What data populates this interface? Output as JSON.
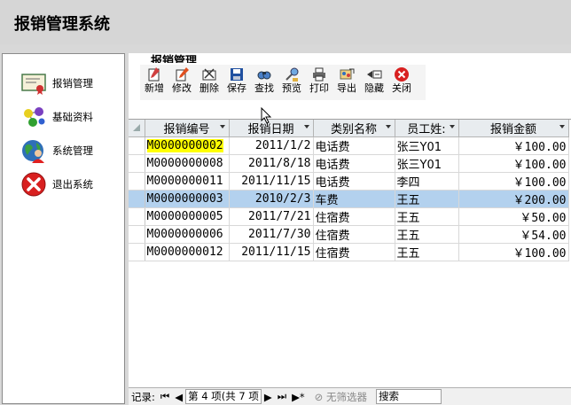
{
  "app": {
    "title": "报销管理系统"
  },
  "sidebar": {
    "items": [
      {
        "label": "报销管理",
        "icon": "certificate-icon"
      },
      {
        "label": "基础资料",
        "icon": "molecules-icon"
      },
      {
        "label": "系统管理",
        "icon": "globe-person-icon"
      },
      {
        "label": "退出系统",
        "icon": "red-x-icon"
      }
    ]
  },
  "section": {
    "title": "报销管理"
  },
  "toolbar": {
    "buttons": [
      {
        "label": "新增",
        "icon": "new-icon"
      },
      {
        "label": "修改",
        "icon": "edit-icon"
      },
      {
        "label": "删除",
        "icon": "delete-icon"
      },
      {
        "label": "保存",
        "icon": "save-icon"
      },
      {
        "label": "查找",
        "icon": "find-icon"
      },
      {
        "label": "预览",
        "icon": "preview-icon"
      },
      {
        "label": "打印",
        "icon": "print-icon"
      },
      {
        "label": "导出",
        "icon": "export-icon"
      },
      {
        "label": "隐藏",
        "icon": "hide-icon"
      },
      {
        "label": "关闭",
        "icon": "close-icon"
      }
    ]
  },
  "table": {
    "columns": [
      "报销编号",
      "报销日期",
      "类别名称",
      "员工姓:",
      "报销金额"
    ],
    "rows": [
      [
        "M0000000002",
        "2011/1/2",
        "电话费",
        "张三Y01",
        "￥100.00"
      ],
      [
        "M0000000008",
        "2011/8/18",
        "电话费",
        "张三Y01",
        "￥100.00"
      ],
      [
        "M0000000011",
        "2011/11/15",
        "电话费",
        "李四",
        "￥100.00"
      ],
      [
        "M0000000003",
        "2010/2/3",
        "车费",
        "王五",
        "￥200.00"
      ],
      [
        "M0000000005",
        "2011/7/21",
        "住宿费",
        "王五",
        "￥50.00"
      ],
      [
        "M0000000006",
        "2011/7/30",
        "住宿费",
        "王五",
        "￥54.00"
      ],
      [
        "M0000000012",
        "2011/11/15",
        "住宿费",
        "王五",
        "￥100.00"
      ]
    ]
  },
  "navigation": {
    "record_label": "记录:",
    "record_text": "第 4 项(共 7 项",
    "filter_label": "无筛选器",
    "search_label": "搜索"
  },
  "colors": {
    "highlight_row": "#b3d1ee",
    "selected_cell": "#ffff00"
  }
}
